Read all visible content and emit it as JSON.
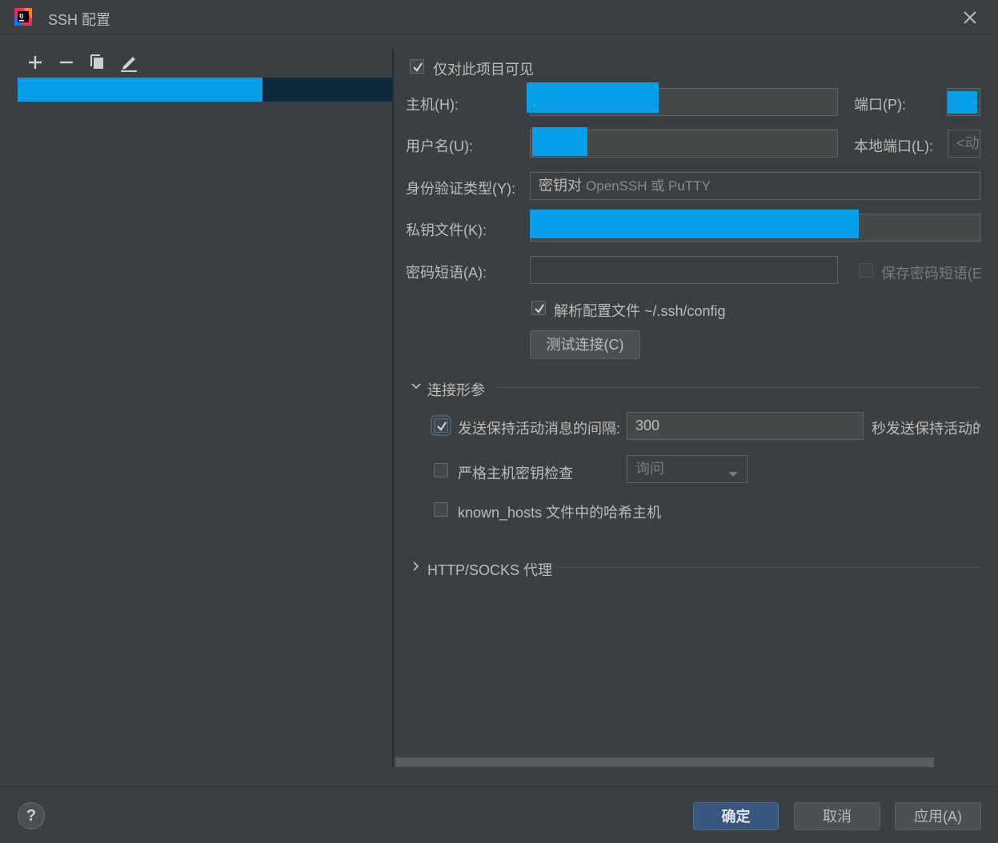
{
  "window": {
    "title": "SSH 配置"
  },
  "toolbar": {
    "icons": [
      "add-icon",
      "remove-icon",
      "copy-icon",
      "edit-icon"
    ]
  },
  "form": {
    "visible_only_project": "仅对此项目可见",
    "host_label": "主机(H):",
    "port_label": "端口(P):",
    "username_label": "用户名(U):",
    "local_port_label": "本地端口(L):",
    "local_port_placeholder": "<动",
    "auth_type_label": "身份验证类型(Y):",
    "auth_type_value_main": "密钥对",
    "auth_type_value_sub": "OpenSSH 或 PuTTY",
    "private_key_label": "私钥文件(K):",
    "passphrase_label": "密码短语(A):",
    "save_passphrase": "保存密码短语(E",
    "parse_config": "解析配置文件 ~/.ssh/config",
    "test_connection": "测试连接(C)"
  },
  "connection_params": {
    "section_title": "连接形参",
    "keepalive_label": "发送保持活动消息的间隔:",
    "keepalive_value": "300",
    "keepalive_suffix": "秒发送保持活动的",
    "strict_host_key": "严格主机密钥检查",
    "strict_host_key_option": "询问",
    "known_hosts_hash": "known_hosts 文件中的哈希主机"
  },
  "proxy": {
    "section_title": "HTTP/SOCKS 代理"
  },
  "footer": {
    "help": "?",
    "ok": "确定",
    "cancel": "取消",
    "apply": "应用(A)"
  },
  "colors": {
    "accent": "#069ee6",
    "primary_button": "#365880",
    "background": "#3c3f41"
  }
}
